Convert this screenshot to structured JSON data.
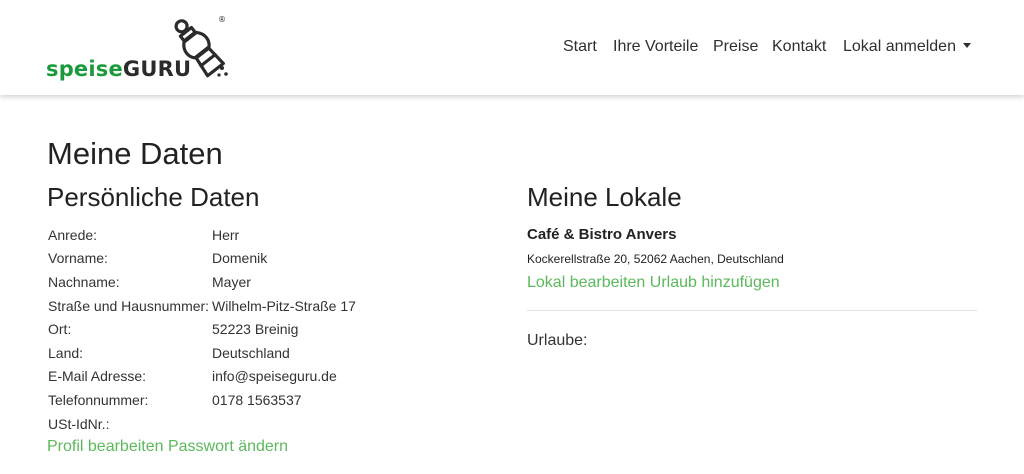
{
  "brand": {
    "logo_part1": "speise",
    "logo_part2": "GURU",
    "registered_mark": "®",
    "green": "#1a9a3a",
    "link_green": "#5cb85c"
  },
  "nav": {
    "items": [
      "Start",
      "Ihre Vorteile",
      "Preise",
      "Kontakt"
    ],
    "dropdown_label": "Lokal anmelden"
  },
  "page": {
    "title": "Meine Daten"
  },
  "personal": {
    "heading": "Persönliche Daten",
    "rows": [
      {
        "label": "Anrede:",
        "value": "Herr"
      },
      {
        "label": "Vorname:",
        "value": "Domenik"
      },
      {
        "label": "Nachname:",
        "value": "Mayer"
      },
      {
        "label": "Straße und Hausnummer:",
        "value": "Wilhelm-Pitz-Straße 17"
      },
      {
        "label": "Ort:",
        "value": "52223 Breinig"
      },
      {
        "label": "Land:",
        "value": "Deutschland"
      },
      {
        "label": "E-Mail Adresse:",
        "value": "info@speiseguru.de"
      },
      {
        "label": "Telefonnummer:",
        "value": "0178 1563537"
      },
      {
        "label": "USt-IdNr.:",
        "value": ""
      }
    ],
    "edit_profile_link": "Profil bearbeiten",
    "change_password_link": "Passwort ändern"
  },
  "venues": {
    "heading": "Meine Lokale",
    "name": "Café & Bistro Anvers",
    "address": "Kockerellstraße 20, 52062 Aachen, Deutschland",
    "edit_link": "Lokal bearbeiten",
    "add_vacation_link": "Urlaub hinzufügen",
    "vacations_label": "Urlaube:"
  }
}
